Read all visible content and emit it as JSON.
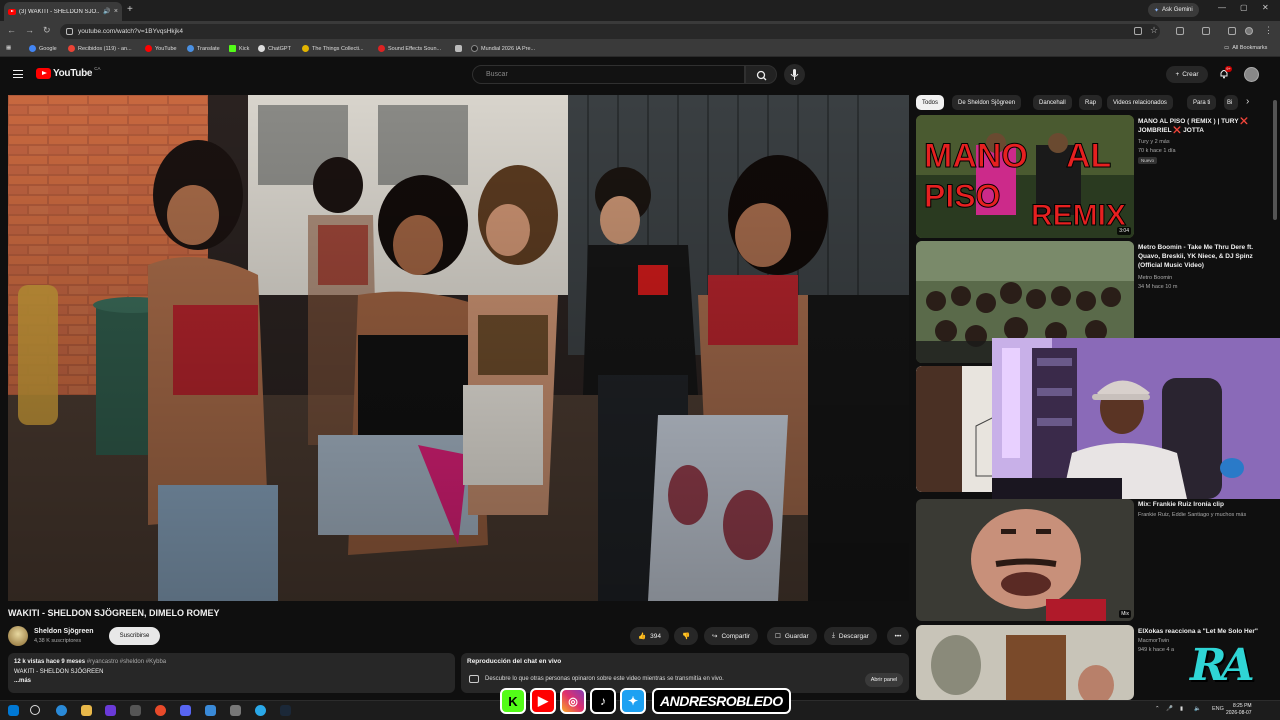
{
  "browser": {
    "tab_title": "(3) WAKITI - SHELDON SJÖ...",
    "tab_close": "×",
    "new_tab": "+",
    "ask_gemini": "Ask Gemini",
    "url": "youtube.com/watch?v=1BYvqsHkjk4",
    "bookmarks": [
      "Google",
      "Recibidos (119) - an...",
      "YouTube",
      "Translate",
      "Kick",
      "ChatGPT",
      "The Things Collecti...",
      "Sound Effects Soun...",
      "",
      "Mundial 2026 IA Pre..."
    ],
    "all_bookmarks": "All Bookmarks"
  },
  "youtube": {
    "logo_text": "YouTube",
    "country": "CA",
    "search_placeholder": "Buscar",
    "create_label": "Crear",
    "notif_count": "9+"
  },
  "video": {
    "title": "WAKITI - SHELDON SJÖGREEN, DIMELO ROMEY",
    "channel": "Sheldon Sjögreen",
    "subscribers": "4,38 K suscriptores",
    "subscribe_label": "Suscribirse",
    "likes": "394",
    "share": "Compartir",
    "save": "Guardar",
    "download": "Descargar",
    "more": "•••",
    "description": {
      "stats": "12 k vistas  hace 9 meses",
      "tags": "#ryancastro #sheldon #Kybba",
      "line2": "WAKITI - SHELDON SJÖGREEN",
      "more": "...más"
    },
    "chat": {
      "title": "Reproducción del chat en vivo",
      "text": "Descubre lo que otras personas opinaron sobre este video mientras se transmitía en vivo.",
      "open": "Abrir panel"
    }
  },
  "chips": [
    "Todos",
    "De Sheldon Sjögreen",
    "Dancehall",
    "Rap",
    "Videos relacionados",
    "Para ti",
    "Bi"
  ],
  "related": [
    {
      "title": "MANO AL PISO ( REMIX ) | TURY ❌ JOMBRIEL ❌ JOTTA",
      "channel": "Tury  y 2 más",
      "meta": "70 k  hace 1 día",
      "badge": "Nuevo",
      "duration": "3:04",
      "thumb_text": "MANO AL PISO REMIX"
    },
    {
      "title": "Metro Boomin - Take Me Thru Dere ft. Quavo, Breskii, YK Niece, & DJ Spinz (Official Music Video)",
      "channel": "Metro Boomin",
      "meta": "34 M  hace 10 m"
    },
    {
      "title": "Mix: Frankie Ruiz  Ironía clip",
      "channel": "Frankie Ruiz, Eddie Santiago y muchos más",
      "badge2": "Mix"
    },
    {
      "title": "ElXokas reacciona a \"Let Me Solo Her\"",
      "channel": "MacmorTwin",
      "meta": "949 k  hace 4 a"
    }
  ],
  "taskbar": {
    "lang": "ENG",
    "time": "8:25 PM",
    "date": "2026-08-07"
  },
  "overlay": {
    "handle": "ANDRESROBLEDO",
    "logo": "RA"
  }
}
